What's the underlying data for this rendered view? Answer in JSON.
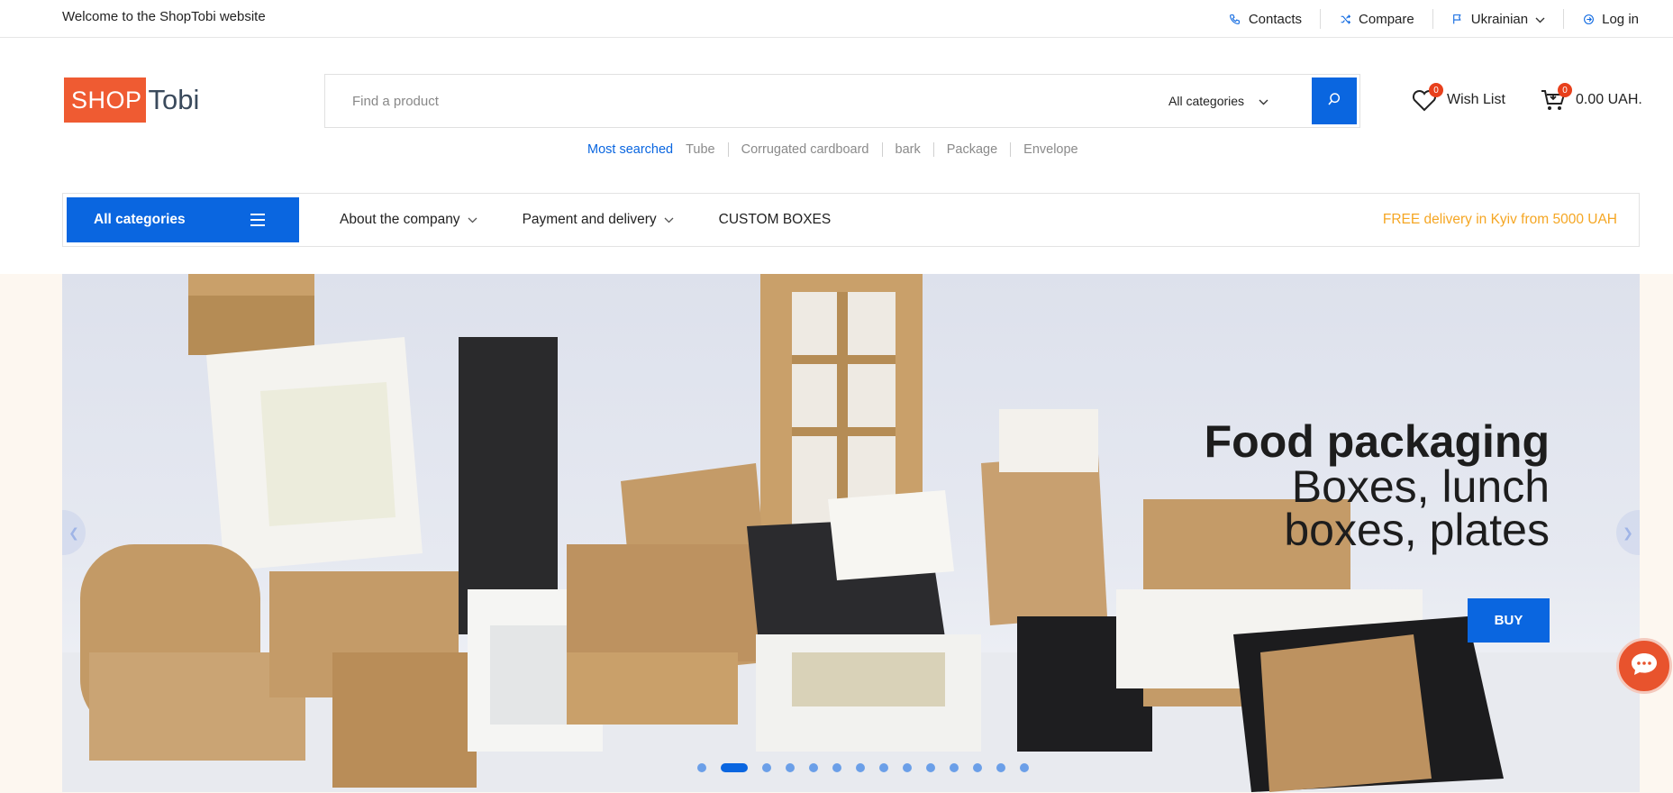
{
  "topbar": {
    "welcome": "Welcome to the ShopTobi website",
    "links": {
      "contacts": "Contacts",
      "compare": "Compare",
      "language": "Ukrainian",
      "login": "Log in"
    }
  },
  "logo": {
    "part1": "SHOP",
    "part2": "Tobi"
  },
  "search": {
    "placeholder": "Find a product",
    "category": "All categories"
  },
  "wishlist": {
    "label": "Wish List",
    "count": "0"
  },
  "cart": {
    "total": "0.00 UAH.",
    "count": "0"
  },
  "popular": {
    "label": "Most searched",
    "terms": [
      "Tube",
      "Corrugated cardboard",
      "bark",
      "Package",
      "Envelope"
    ]
  },
  "nav": {
    "all_categories": "All categories",
    "items": [
      "About the company",
      "Payment and delivery",
      "CUSTOM BOXES"
    ],
    "promo": "FREE delivery in Kyiv from 5000 UAH"
  },
  "hero": {
    "title": "Food packaging",
    "subtitle_line1": "Boxes, lunch",
    "subtitle_line2": "boxes, plates",
    "button": "BUY",
    "slides": 14,
    "active_slide": 2
  },
  "colors": {
    "accent": "#0a66e0",
    "brand": "#ef5b32",
    "promo": "#f5a623",
    "badge": "#e8401c"
  },
  "icons": [
    "phone-icon",
    "shuffle-icon",
    "flag-icon",
    "login-icon",
    "chevron-down-icon",
    "search-icon",
    "heart-icon",
    "cart-icon",
    "menu-icon",
    "chat-icon"
  ]
}
